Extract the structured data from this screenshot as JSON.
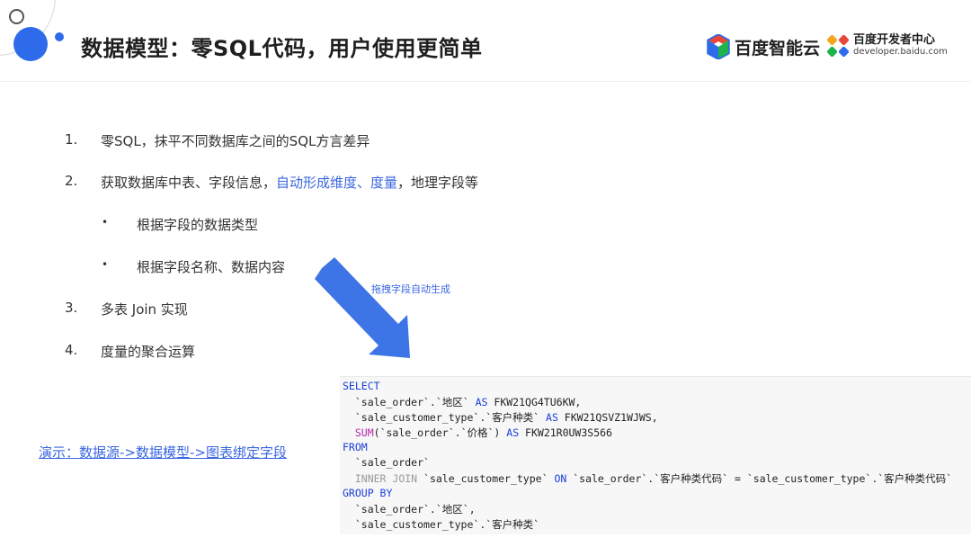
{
  "title": "数据模型：零SQL代码，用户使用更简单",
  "logos": {
    "baidu_ai_cloud": "百度智能云",
    "developer_center": "百度开发者中心",
    "developer_url": "developer.baidu.com"
  },
  "list": [
    {
      "number": "1.",
      "text": "零SQL，抹平不同数据库之间的SQL方言差异"
    },
    {
      "number": "2.",
      "text_before": "获取数据库中表、字段信息，",
      "text_highlight": "自动形成维度、度量",
      "text_after": "，地理字段等"
    },
    {
      "bullet": "•",
      "text": "根据字段的数据类型"
    },
    {
      "bullet": "•",
      "text": "根据字段名称、数据内容"
    },
    {
      "number": "3.",
      "text": "多表 Join 实现"
    },
    {
      "number": "4.",
      "text": "度量的聚合运算"
    }
  ],
  "arrow_label": "拖拽字段自动生成",
  "demo_link": "演示：数据源->数据模型->图表绑定字段",
  "sql": {
    "select": "SELECT",
    "line1": "  `sale_order`.`地区` ",
    "as": "AS",
    "line1_alias": " FKW21QG4TU6KW,",
    "line2": "  `sale_customer_type`.`客户种类` ",
    "line2_alias": " FKW21QSVZ1WJWS,",
    "sum_fn": "SUM",
    "line3_mid": "(`sale_order`.`价格`) ",
    "line3_alias": " FKW21R0UW3S566",
    "from": "FROM",
    "line4": "  `sale_order`",
    "inner_join": "INNER JOIN",
    "line5_mid": " `sale_customer_type` ",
    "on": "ON",
    "line5_rest": " `sale_order`.`客户种类代码` = `sale_customer_type`.`客户种类代码`",
    "group_by": "GROUP BY",
    "line6": "  `sale_order`.`地区`,",
    "line7": "  `sale_customer_type`.`客户种类`"
  },
  "colors": {
    "accent": "#2e6bea",
    "link": "#3a66e0",
    "arrow": "#3d74e6",
    "keyword": "#1a3fd6",
    "function": "#b52aa5"
  }
}
